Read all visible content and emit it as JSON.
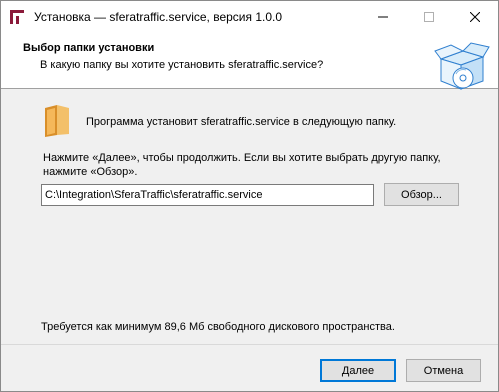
{
  "window": {
    "title": "Установка — sferatraffic.service, версия 1.0.0"
  },
  "header": {
    "title": "Выбор папки установки",
    "subtitle": "В какую папку вы хотите установить sferatraffic.service?"
  },
  "main": {
    "info_text": "Программа установит sferatraffic.service в следующую папку.",
    "instruction": "Нажмите «Далее», чтобы продолжить. Если вы хотите выбрать другую папку, нажмите «Обзор».",
    "path_value": "C:\\Integration\\SferaTraffic\\sferatraffic.service",
    "browse_label": "Обзор...",
    "space_required": "Требуется как минимум 89,6 Мб свободного дискового пространства."
  },
  "footer": {
    "next_label": "Далее",
    "cancel_label": "Отмена"
  },
  "colors": {
    "accent": "#0078d7",
    "folder": "#e8a33c"
  },
  "icons": [
    "installer-app-icon",
    "minimize-icon",
    "maximize-icon",
    "close-icon",
    "setup-box-icon",
    "folder-icon"
  ]
}
